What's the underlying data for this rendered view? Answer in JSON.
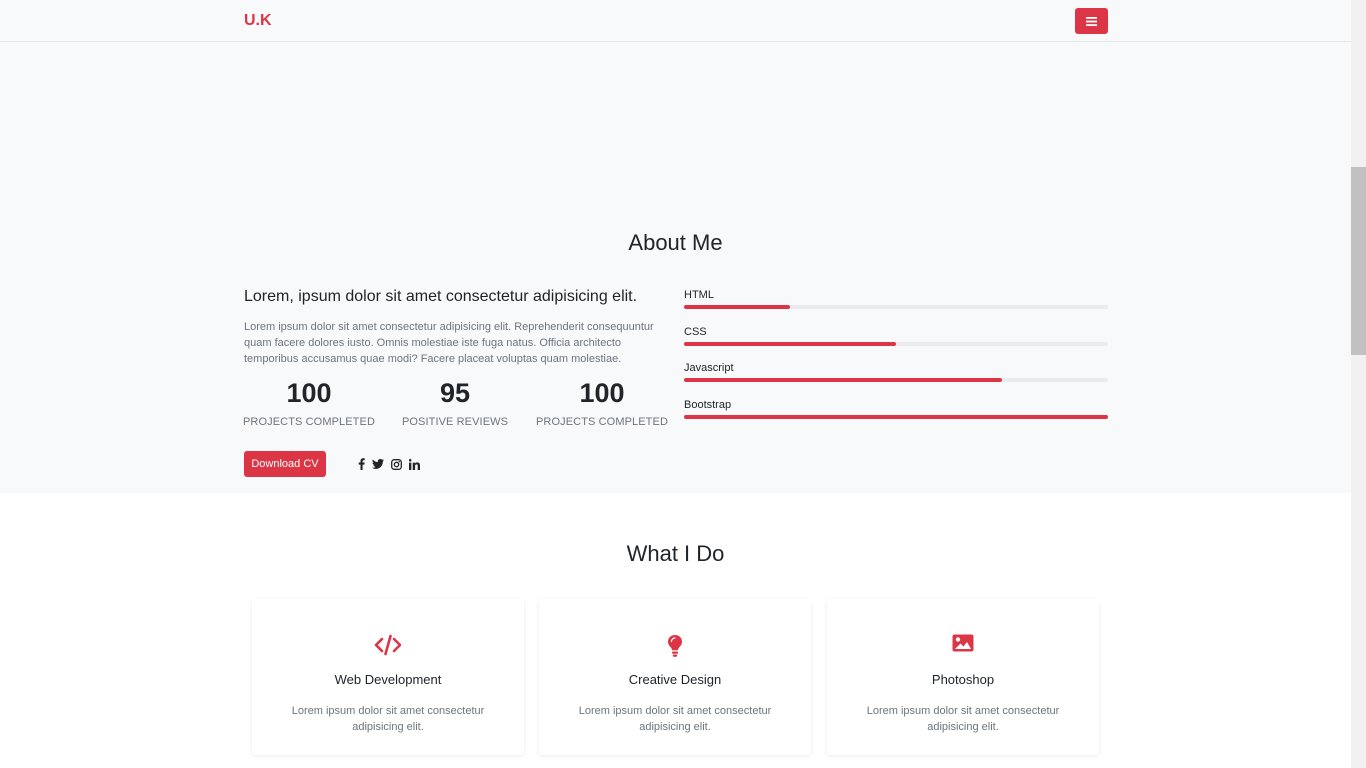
{
  "navbar": {
    "brand": "U.K",
    "menu_icon": "hamburger-icon"
  },
  "about": {
    "title": "About Me",
    "heading": "Lorem, ipsum dolor sit amet consectetur adipisicing elit.",
    "text": "Lorem ipsum dolor sit amet consectetur adipisicing elit. Reprehenderit consequuntur quam facere dolores iusto. Omnis molestiae iste fuga natus. Officia architecto temporibus accusamus quae modi? Facere placeat voluptas quam molestiae.",
    "stats": [
      {
        "value": "100",
        "label": "PROJECTS COMPLETED"
      },
      {
        "value": "95",
        "label": "POSITIVE REVIEWS"
      },
      {
        "value": "100",
        "label": "PROJECTS COMPLETED"
      }
    ],
    "download_label": "Download CV",
    "social_icons": [
      "facebook-icon",
      "twitter-icon",
      "instagram-icon",
      "linkedin-icon"
    ],
    "skills": [
      {
        "name": "HTML",
        "level": 0.25
      },
      {
        "name": "CSS",
        "level": 0.5
      },
      {
        "name": "Javascript",
        "level": 0.75
      },
      {
        "name": "Bootstrap",
        "level": 1.0
      }
    ]
  },
  "services": {
    "title": "What I Do",
    "items": [
      {
        "icon": "code-icon",
        "title": "Web Development",
        "text": "Lorem ipsum dolor sit amet consectetur adipisicing elit."
      },
      {
        "icon": "lightbulb-icon",
        "title": "Creative Design",
        "text": "Lorem ipsum dolor sit amet consectetur adipisicing elit."
      },
      {
        "icon": "image-icon",
        "title": "Photoshop",
        "text": "Lorem ipsum dolor sit amet consectetur adipisicing elit."
      }
    ]
  },
  "colors": {
    "accent": "#dc3545",
    "section_bg": "#f8f9fa",
    "muted_text": "#6c757d"
  }
}
